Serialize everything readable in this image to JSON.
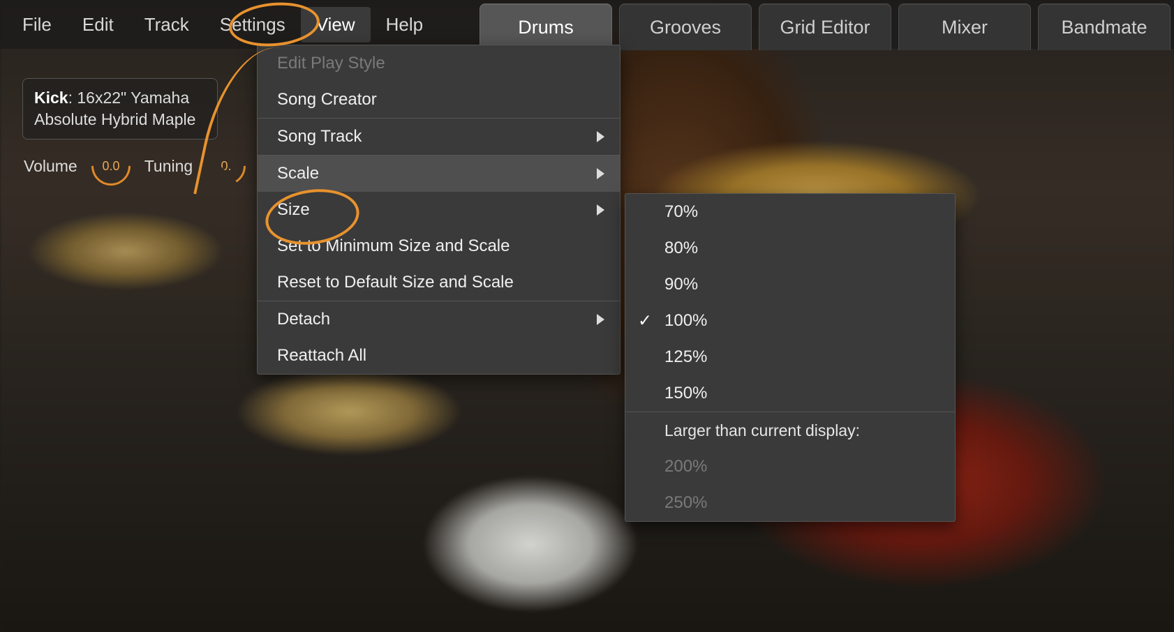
{
  "menu": {
    "file": "File",
    "edit": "Edit",
    "track": "Track",
    "settings": "Settings",
    "view": "View",
    "help": "Help"
  },
  "tabs": {
    "drums": "Drums",
    "grooves": "Grooves",
    "grid": "Grid Editor",
    "mixer": "Mixer",
    "bandmate": "Bandmate"
  },
  "info": {
    "label": "Kick",
    "sep": ": ",
    "value": "16x22\" Yamaha Absolute Hybrid Maple"
  },
  "controls": {
    "volume_label": "Volume",
    "volume_value": "0.0",
    "tuning_label": "Tuning",
    "tuning_value": "0."
  },
  "view_menu": {
    "edit_play_style": "Edit Play Style",
    "song_creator": "Song Creator",
    "song_track": "Song Track",
    "scale": "Scale",
    "size": "Size",
    "min_size": "Set to Minimum Size and Scale",
    "reset": "Reset to Default Size and Scale",
    "detach": "Detach",
    "reattach": "Reattach All"
  },
  "scale_menu": {
    "p70": "70%",
    "p80": "80%",
    "p90": "90%",
    "p100": "100%",
    "p125": "125%",
    "p150": "150%",
    "larger_header": "Larger than current display:",
    "p200": "200%",
    "p250": "250%",
    "selected": "100%"
  }
}
